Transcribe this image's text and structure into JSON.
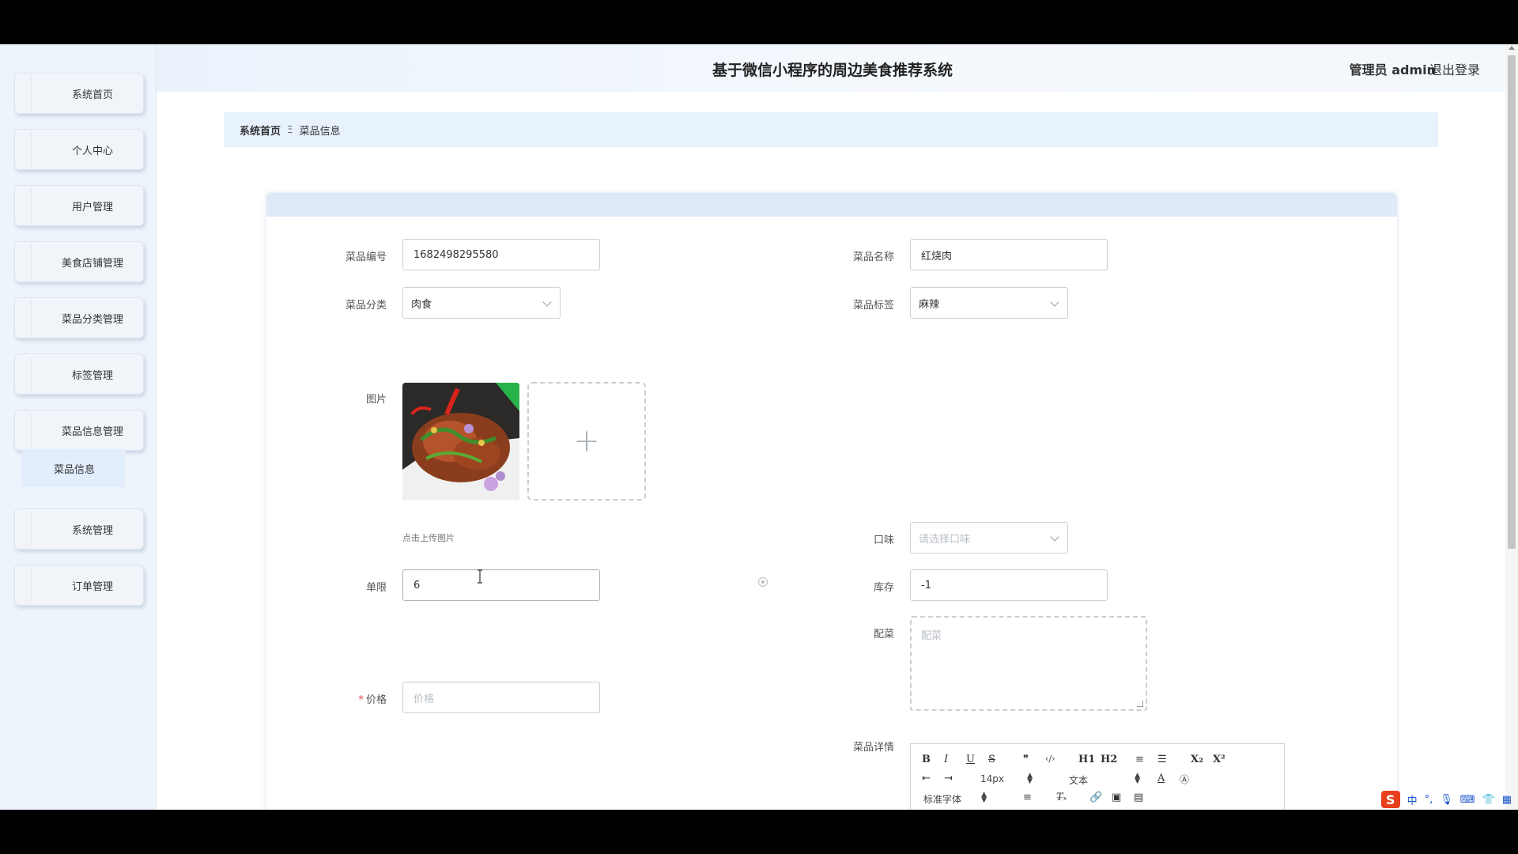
{
  "header": {
    "title": "基于微信小程序的周边美食推荐系统",
    "user": "管理员 admin",
    "logout": "退出登录"
  },
  "sidebar": {
    "items": [
      {
        "label": "系统首页"
      },
      {
        "label": "个人中心"
      },
      {
        "label": "用户管理"
      },
      {
        "label": "美食店铺管理"
      },
      {
        "label": "菜品分类管理"
      },
      {
        "label": "标签管理"
      },
      {
        "label": "菜品信息管理"
      },
      {
        "label": "系统管理"
      },
      {
        "label": "订单管理"
      }
    ],
    "submenu_active": "菜品信息"
  },
  "breadcrumb": {
    "home": "系统首页",
    "separator": "Ξ",
    "current": "菜品信息"
  },
  "form": {
    "code_label": "菜品编号",
    "code_value": "1682498295580",
    "name_label": "菜品名称",
    "name_value": "红烧肉",
    "category_label": "菜品分类",
    "category_value": "肉食",
    "tag_label": "菜品标签",
    "tag_value": "麻辣",
    "image_label": "图片",
    "upload_hint": "点击上传图片",
    "taste_label": "口味",
    "taste_placeholder": "请选择口味",
    "limit_label": "单限",
    "limit_value": "6",
    "stock_label": "库存",
    "stock_value": "-1",
    "side_label": "配菜",
    "side_placeholder": "配菜",
    "price_label": "价格",
    "price_placeholder": "价格",
    "price_required_mark": "*",
    "detail_label": "菜品详情"
  },
  "editor": {
    "row1": [
      "B",
      "I",
      "U",
      "S",
      "❞",
      "‹/›",
      "H1",
      "H2",
      "≡",
      "☰",
      "X₂",
      "X²"
    ],
    "font_size": "14px",
    "text_type": "文本",
    "font_family": "标准字体"
  },
  "tray": {
    "ime_label": "中"
  },
  "colors": {
    "accent": "#e8f2fd",
    "sidebar_bg": "#eef4fb",
    "required": "#e64545"
  }
}
